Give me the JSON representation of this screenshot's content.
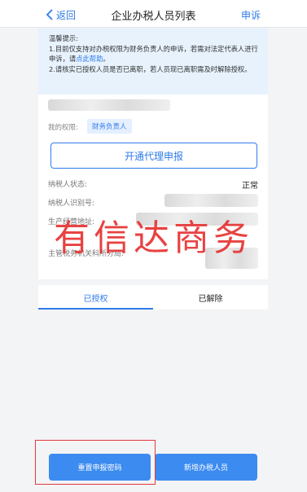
{
  "nav": {
    "back_label": "返回",
    "title": "企业办税人员列表",
    "right_label": "申诉"
  },
  "tips": {
    "title": "温馨提示:",
    "line1_prefix": "1.目前仅支持对办税权限为财务负责人的申诉，若需对法定代表人进行申诉，请",
    "line1_link": "点此帮助",
    "line1_suffix": "。",
    "line2": "2.请核实已授权人员是否已离职，若人员现已离职需及时解除授权。"
  },
  "profile": {
    "permission_label": "我的权限:",
    "permission_badge": "财务负责人",
    "proxy_button": "开通代理申报",
    "taxpayer_status_label": "纳税人状态:",
    "taxpayer_status_value": "正常",
    "taxpayer_id_label": "纳税人识别号:",
    "address_label": "生产经营地址:",
    "tax_office_label": "主管税务机关科所分局:"
  },
  "tabs": [
    {
      "label": "已授权",
      "active": true
    },
    {
      "label": "已解除",
      "active": false
    }
  ],
  "actions": {
    "reset_button": "重置申报密码",
    "add_button": "新增办税人员"
  },
  "watermark": "有信达商务",
  "colors": {
    "accent": "#2f7bea",
    "button": "#3c8bf0",
    "tips_bg": "#e7f2fd",
    "highlight_frame": "#e3393c"
  }
}
